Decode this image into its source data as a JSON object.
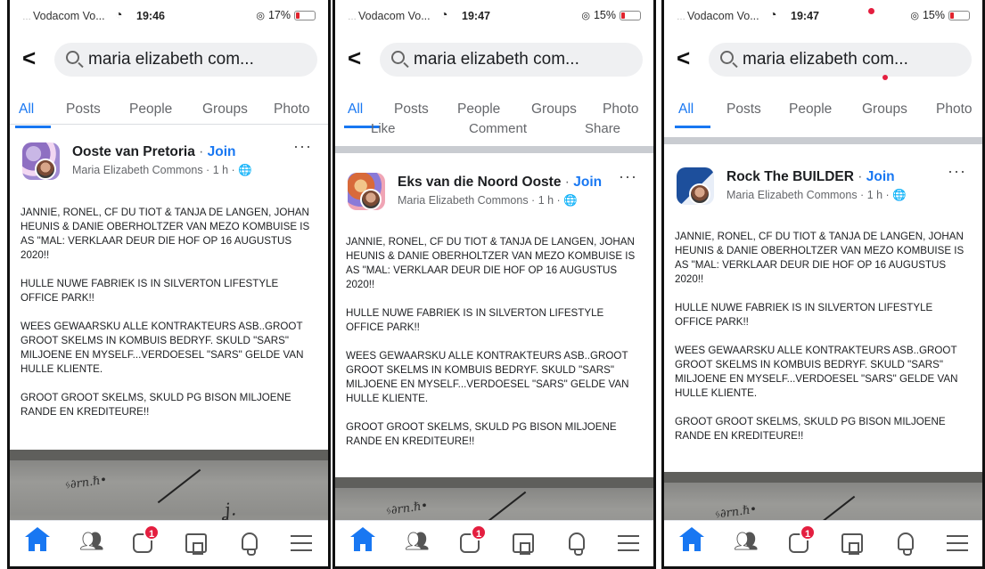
{
  "screens": [
    {
      "status": {
        "carrier": "Vodacom Vo...",
        "time": "19:46",
        "battery": "17%"
      },
      "search": {
        "query": "maria elizabeth com..."
      },
      "tabs": [
        "All",
        "Posts",
        "People",
        "Groups",
        "Photo"
      ],
      "post": {
        "group": "Ooste van Pretoria",
        "separator": "·",
        "join": "Join",
        "meta": "Maria Elizabeth Commons · 1 h · 🌐",
        "more": "···",
        "paragraphs": [
          "JANNIE, RONEL, CF DU TIOT & TANJA DE LANGEN, JOHAN HEUNIS & DANIE OBERHOLTZER VAN MEZO KOMBUISE IS AS \"MAL: VERKLAAR DEUR DIE HOF OP 16 AUGUSTUS 2020!!",
          "HULLE NUWE FABRIEK IS IN SILVERTON LIFESTYLE OFFICE PARK!!",
          "WEES GEWAARSKU ALLE KONTRAKTEURS ASB..GROOT GROOT SKELMS IN KOMBUIS BEDRYF. SKULD \"SARS\" MILJOENE EN MYSELF...VERDOESEL \"SARS\" GELDE VAN HULLE KLIENTE.",
          "GROOT GROOT SKELMS, SKULD PG BISON MILJOENE RANDE EN KREDITEURE!!"
        ]
      },
      "notification_badge": "1"
    },
    {
      "status": {
        "carrier": "Vodacom Vo...",
        "time": "19:47",
        "battery": "15%"
      },
      "search": {
        "query": "maria elizabeth com..."
      },
      "tabs": [
        "All",
        "Posts",
        "People",
        "Groups",
        "Photo"
      ],
      "previous_actions": [
        "Like",
        "Comment",
        "Share"
      ],
      "post": {
        "group": "Eks van die Noord Ooste",
        "separator": "·",
        "join": "Join",
        "meta": "Maria Elizabeth Commons · 1 h · 🌐",
        "more": "···",
        "paragraphs": [
          "JANNIE, RONEL, CF DU TIOT & TANJA DE LANGEN, JOHAN HEUNIS & DANIE OBERHOLTZER VAN MEZO KOMBUISE IS AS \"MAL: VERKLAAR DEUR DIE HOF OP 16 AUGUSTUS 2020!!",
          "HULLE NUWE FABRIEK IS IN SILVERTON LIFESTYLE OFFICE PARK!!",
          "WEES GEWAARSKU ALLE KONTRAKTEURS ASB..GROOT GROOT SKELMS IN KOMBUIS BEDRYF. SKULD \"SARS\" MILJOENE EN MYSELF...VERDOESEL \"SARS\" GELDE VAN HULLE KLIENTE.",
          "GROOT GROOT SKELMS, SKULD PG BISON MILJOENE RANDE EN KREDITEURE!!"
        ]
      },
      "notification_badge": "1"
    },
    {
      "status": {
        "carrier": "Vodacom Vo...",
        "time": "19:47",
        "battery": "15%"
      },
      "search": {
        "query": "maria elizabeth com..."
      },
      "tabs": [
        "All",
        "Posts",
        "People",
        "Groups",
        "Photo"
      ],
      "post": {
        "group": "Rock The BUILDER",
        "separator": "·",
        "join": "Join",
        "meta": "Maria Elizabeth Commons · 1 h · 🌐",
        "more": "···",
        "paragraphs": [
          "JANNIE, RONEL, CF DU TIOT & TANJA DE LANGEN, JOHAN HEUNIS & DANIE OBERHOLTZER VAN MEZO KOMBUISE IS AS \"MAL: VERKLAAR DEUR DIE HOF OP 16 AUGUSTUS 2020!!",
          "HULLE NUWE FABRIEK IS IN SILVERTON LIFESTYLE OFFICE PARK!!",
          "WEES GEWAARSKU ALLE KONTRAKTEURS ASB..GROOT GROOT SKELMS IN KOMBUIS BEDRYF. SKULD \"SARS\" MILJOENE EN MYSELF...VERDOESEL \"SARS\" GELDE VAN HULLE KLIENTE.",
          "GROOT GROOT SKELMS, SKULD PG BISON MILJOENE RANDE EN KREDITEURE!!"
        ]
      },
      "notification_badge": "1"
    }
  ],
  "colors": {
    "accent": "#1877f2",
    "badge": "#e41e3f",
    "muted": "#65676b"
  },
  "icons": [
    "back-arrow-icon",
    "search-icon",
    "home-icon",
    "friends-icon",
    "watch-icon",
    "marketplace-icon",
    "bell-icon",
    "menu-icon",
    "globe-icon"
  ]
}
